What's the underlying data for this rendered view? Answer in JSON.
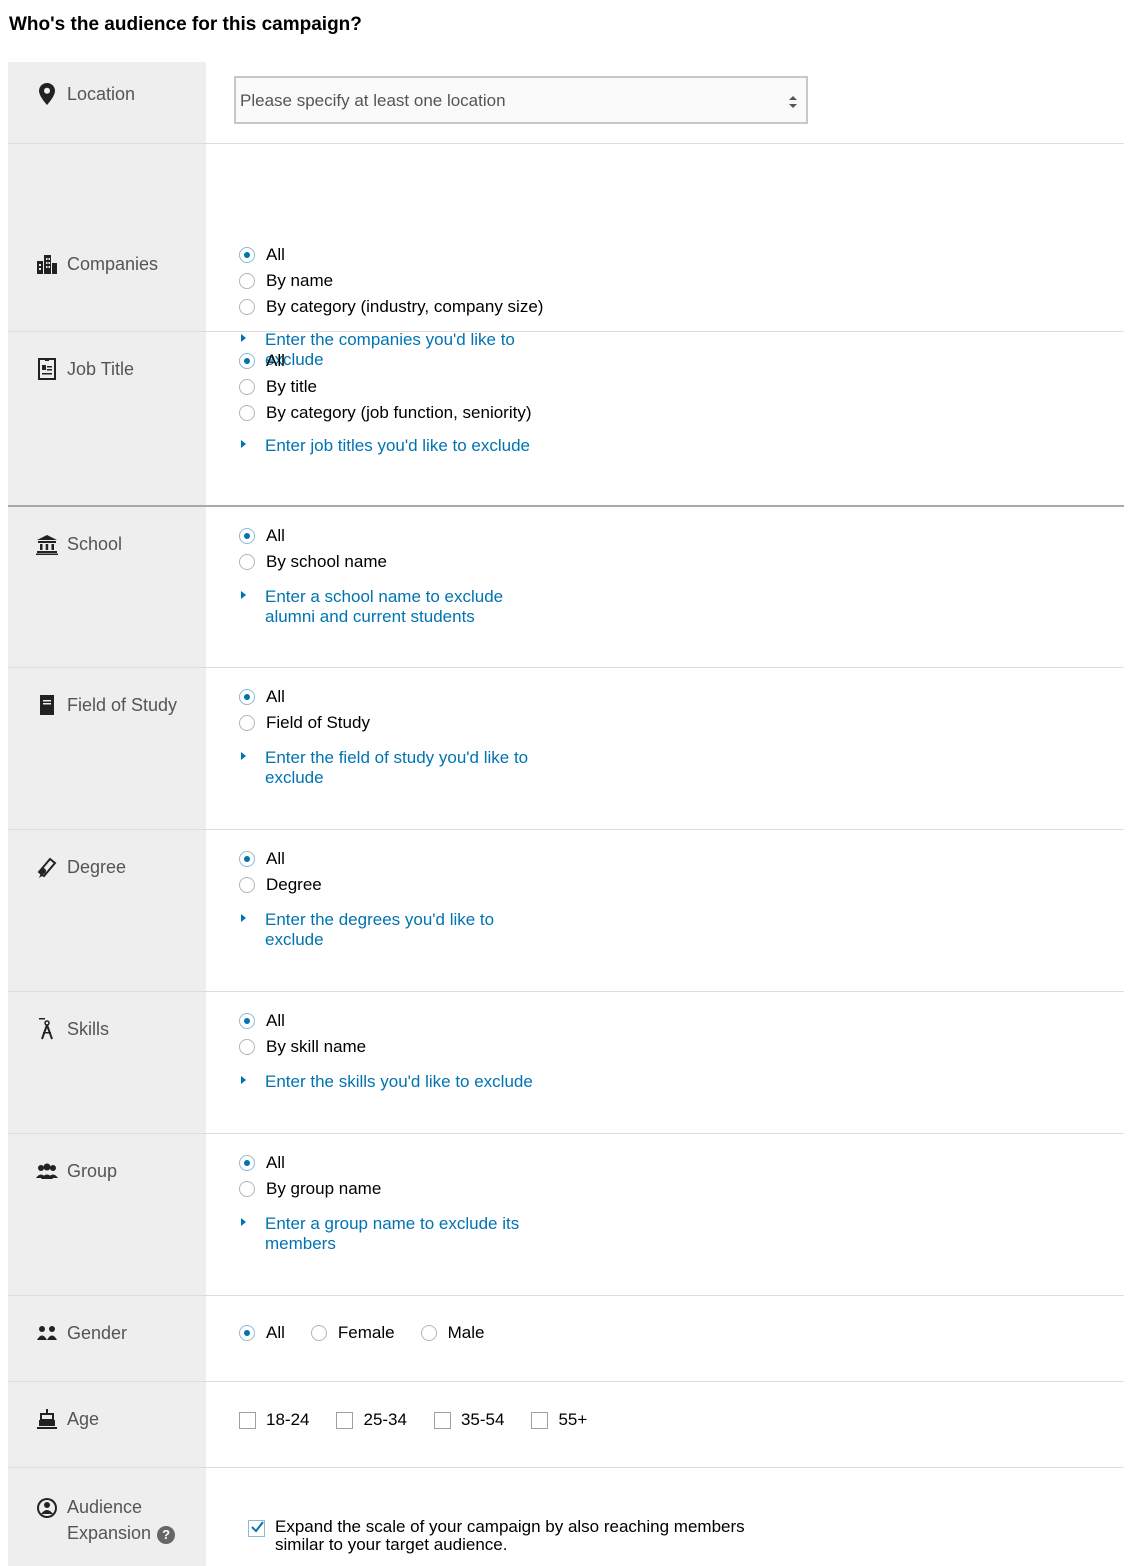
{
  "page": {
    "title": "Who's the audience for this campaign?"
  },
  "location": {
    "label": "Location",
    "icon": "map-pin-icon",
    "placeholder": "Please specify at least one location"
  },
  "companies": {
    "label": "Companies",
    "icon": "buildings-icon",
    "options": [
      "All",
      "By name",
      "By category (industry, company size)"
    ],
    "selected": "All",
    "exclude": "Enter the companies you'd like to exclude"
  },
  "job_title": {
    "label": "Job Title",
    "icon": "id-badge-icon",
    "options": [
      "All",
      "By title",
      "By category (job function, seniority)"
    ],
    "selected": "All",
    "exclude": "Enter job titles you'd like to exclude"
  },
  "school": {
    "label": "School",
    "icon": "school-building-icon",
    "options": [
      "All",
      "By school name"
    ],
    "selected": "All",
    "exclude": "Enter a school name to exclude alumni and current students"
  },
  "field_of_study": {
    "label": "Field of Study",
    "icon": "book-icon",
    "options": [
      "All",
      "Field of Study"
    ],
    "selected": "All",
    "exclude": "Enter the field of study you'd like to exclude"
  },
  "degree": {
    "label": "Degree",
    "icon": "diploma-icon",
    "options": [
      "All",
      "Degree"
    ],
    "selected": "All",
    "exclude": "Enter the degrees you'd like to exclude"
  },
  "skills": {
    "label": "Skills",
    "icon": "compass-tool-icon",
    "options": [
      "All",
      "By skill name"
    ],
    "selected": "All",
    "exclude": "Enter the skills you'd like to exclude"
  },
  "group": {
    "label": "Group",
    "icon": "group-people-icon",
    "options": [
      "All",
      "By group name"
    ],
    "selected": "All",
    "exclude": "Enter a group name to exclude its members"
  },
  "gender": {
    "label": "Gender",
    "icon": "gender-people-icon",
    "options": [
      "All",
      "Female",
      "Male"
    ],
    "selected": "All"
  },
  "age": {
    "label": "Age",
    "icon": "cake-icon",
    "options": [
      "18-24",
      "25-34",
      "35-54",
      "55+"
    ]
  },
  "audience_expansion": {
    "label_line1": "Audience",
    "label_line2": "Expansion",
    "icon": "person-circle-icon",
    "help": "?",
    "checkbox_text": "Expand the scale of your campaign by also reaching members similar to your target audience.",
    "checked": true
  },
  "colors": {
    "link": "#0073b1",
    "label_bg": "#eeeeee",
    "label_text": "#555555"
  }
}
